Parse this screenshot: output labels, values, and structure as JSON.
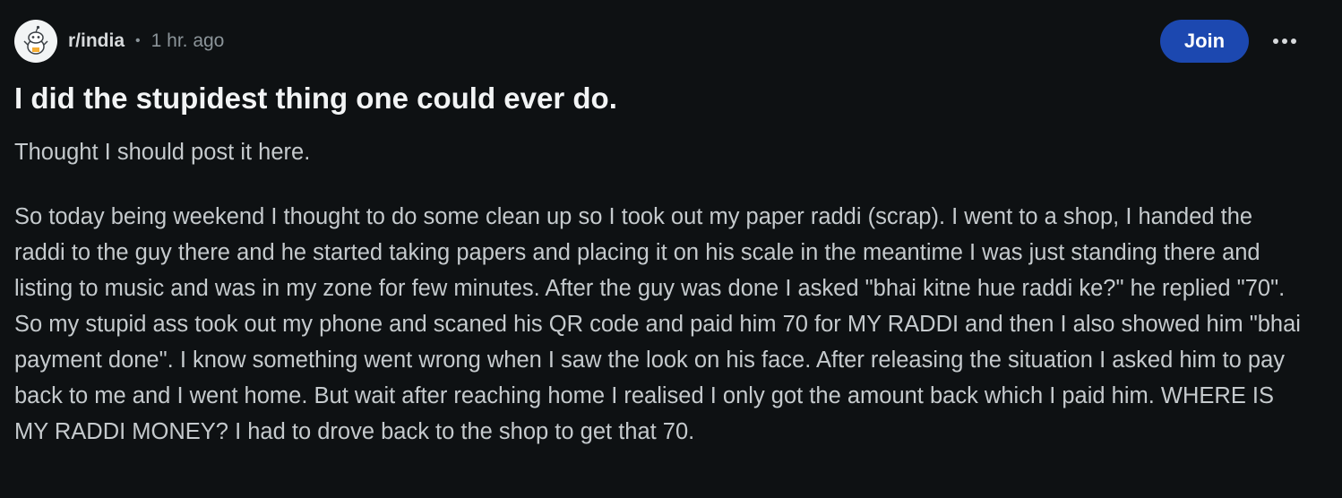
{
  "post": {
    "subreddit": "r/india",
    "separator": "•",
    "time_ago": "1 hr. ago",
    "join_label": "Join",
    "title": "I did the stupidest thing one could ever do.",
    "paragraphs": [
      "Thought I should post it here.",
      "So today being weekend I thought to do some clean up so I took out my paper raddi (scrap). I went to a shop, I handed the raddi to the guy there and he started taking papers and placing it on his scale in the meantime I was just standing there and listing to music and was in my zone for few minutes. After the guy was done I asked \"bhai kitne hue raddi ke?\" he replied \"70\". So my stupid ass took out my phone and scaned his QR code and paid him 70 for MY RADDI and then I also showed him \"bhai payment done\". I know something went wrong when I saw the look on his face. After releasing the situation I asked him to pay back to me and I went home. But wait after reaching home I realised I only got the amount back which I paid him. WHERE IS MY RADDI MONEY? I had to drove back to the shop to get that 70."
    ]
  },
  "icons": {
    "avatar": "subreddit-avatar-icon",
    "more": "more-options-icon"
  },
  "colors": {
    "background": "#0e1113",
    "join_button": "#1c48b0",
    "text_primary": "#f2f4f5",
    "text_body": "#c5cacd",
    "text_muted": "#8b9499"
  }
}
